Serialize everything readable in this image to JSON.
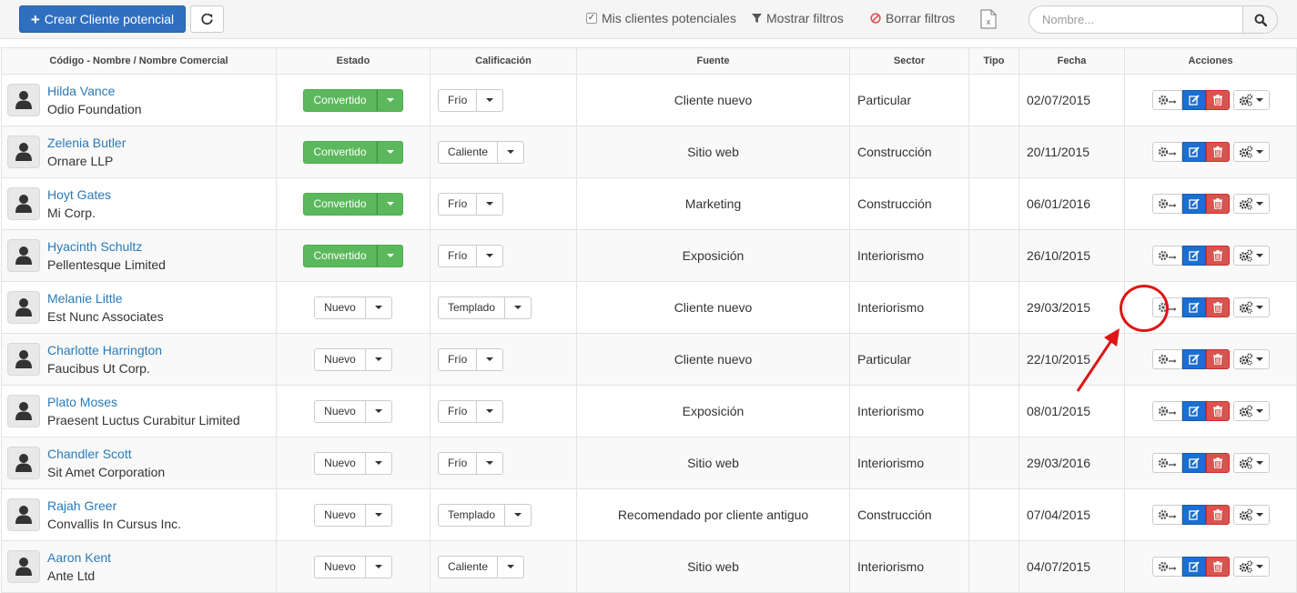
{
  "toolbar": {
    "create_label": "Crear Cliente potencial",
    "mine_label": "Mis clientes potenciales",
    "mine_checked": true,
    "show_filters_label": "Mostrar filtros",
    "clear_filters_label": "Borrar filtros"
  },
  "search": {
    "placeholder": "Nombre..."
  },
  "table": {
    "headers": {
      "name": "Código - Nombre / Nombre Comercial",
      "status": "Estado",
      "rating": "Calificación",
      "source": "Fuente",
      "sector": "Sector",
      "type": "Tipo",
      "date": "Fecha",
      "actions": "Acciones"
    },
    "rows": [
      {
        "name": "Hilda Vance",
        "company": "Odio Foundation",
        "status": "Convertido",
        "rating": "Frío",
        "source": "Cliente nuevo",
        "sector": "Particular",
        "type": "",
        "date": "02/07/2015"
      },
      {
        "name": "Zelenia Butler",
        "company": "Ornare LLP",
        "status": "Convertido",
        "rating": "Caliente",
        "source": "Sitio web",
        "sector": "Construcción",
        "type": "",
        "date": "20/11/2015"
      },
      {
        "name": "Hoyt Gates",
        "company": "Mi Corp.",
        "status": "Convertido",
        "rating": "Frío",
        "source": "Marketing",
        "sector": "Construcción",
        "type": "",
        "date": "06/01/2016"
      },
      {
        "name": "Hyacinth Schultz",
        "company": "Pellentesque Limited",
        "status": "Convertido",
        "rating": "Frío",
        "source": "Exposición",
        "sector": "Interiorismo",
        "type": "",
        "date": "26/10/2015"
      },
      {
        "name": "Melanie Little",
        "company": "Est Nunc Associates",
        "status": "Nuevo",
        "rating": "Templado",
        "source": "Cliente nuevo",
        "sector": "Interiorismo",
        "type": "",
        "date": "29/03/2015"
      },
      {
        "name": "Charlotte Harrington",
        "company": "Faucibus Ut Corp.",
        "status": "Nuevo",
        "rating": "Frío",
        "source": "Cliente nuevo",
        "sector": "Particular",
        "type": "",
        "date": "22/10/2015"
      },
      {
        "name": "Plato Moses",
        "company": "Praesent Luctus Curabitur Limited",
        "status": "Nuevo",
        "rating": "Frío",
        "source": "Exposición",
        "sector": "Interiorismo",
        "type": "",
        "date": "08/01/2015"
      },
      {
        "name": "Chandler Scott",
        "company": "Sit Amet Corporation",
        "status": "Nuevo",
        "rating": "Frío",
        "source": "Sitio web",
        "sector": "Interiorismo",
        "type": "",
        "date": "29/03/2016"
      },
      {
        "name": "Rajah Greer",
        "company": "Convallis In Cursus Inc.",
        "status": "Nuevo",
        "rating": "Templado",
        "source": "Recomendado por cliente antiguo",
        "sector": "Construcción",
        "type": "",
        "date": "07/04/2015"
      },
      {
        "name": "Aaron Kent",
        "company": "Ante Ltd",
        "status": "Nuevo",
        "rating": "Caliente",
        "source": "Sitio web",
        "sector": "Interiorismo",
        "type": "",
        "date": "04/07/2015"
      }
    ]
  },
  "colors": {
    "primary": "#2f6fc0",
    "converted": "#5cb85c",
    "edit": "#1a6fd0",
    "delete": "#d9534f",
    "link": "#2a7ab8",
    "annotation": "#e01414"
  },
  "icons": {
    "create": "plus-icon",
    "refresh": "refresh-icon",
    "filter": "filter-icon",
    "clear": "ban-icon",
    "export": "excel-icon",
    "search": "search-icon",
    "avatar": "user-icon",
    "convert": "gear-arrow-icon",
    "edit": "edit-icon",
    "delete": "trash-icon",
    "more": "cogs-icon"
  }
}
